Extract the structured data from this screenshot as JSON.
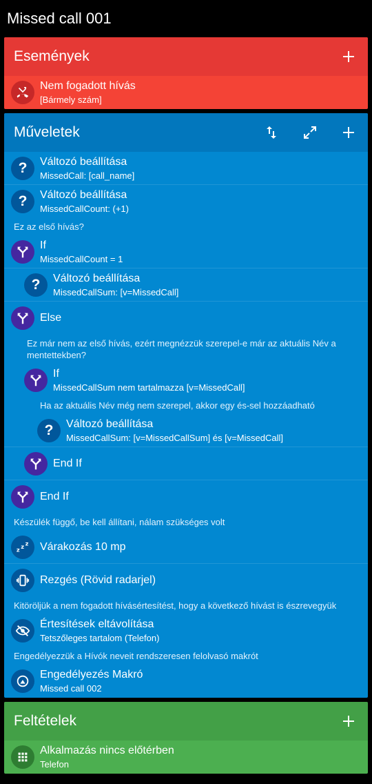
{
  "title": "Missed call 001",
  "triggers": {
    "header": "Események",
    "items": [
      {
        "title": "Nem fogadott hívás",
        "sub": "[Bármely szám]"
      }
    ]
  },
  "actions": {
    "header": "Műveletek",
    "rows": [
      {
        "kind": "item",
        "indent": 0,
        "icon": "question-icon",
        "title": "Változó beállítása",
        "sub": "MissedCall: [call_name]"
      },
      {
        "kind": "item",
        "indent": 0,
        "icon": "question-icon",
        "title": "Változó beállítása",
        "sub": "MissedCallCount: (+1)"
      },
      {
        "kind": "comment",
        "indent": 0,
        "text": "Ez az első hívás?"
      },
      {
        "kind": "item",
        "indent": 0,
        "icon": "branch-icon",
        "title": "If",
        "sub": "MissedCallCount = 1"
      },
      {
        "kind": "item",
        "indent": 1,
        "icon": "question-icon",
        "title": "Változó beállítása",
        "sub": "MissedCallSum: [v=MissedCall]"
      },
      {
        "kind": "item",
        "indent": 0,
        "icon": "branch-icon",
        "title": "Else",
        "sub": ""
      },
      {
        "kind": "comment",
        "indent": 1,
        "text": "Ez már nem az első hívás, ezért megnézzük szerepel-e már az aktuális Név a mentettekben?"
      },
      {
        "kind": "item",
        "indent": 1,
        "icon": "branch-icon",
        "title": "If",
        "sub": "MissedCallSum nem tartalmazza [v=MissedCall]"
      },
      {
        "kind": "comment",
        "indent": 2,
        "text": "Ha az aktuális Név még nem szerepel, akkor egy és-sel hozzáadható"
      },
      {
        "kind": "item",
        "indent": 2,
        "icon": "question-icon",
        "title": "Változó beállítása",
        "sub": "MissedCallSum: [v=MissedCallSum] és [v=MissedCall]"
      },
      {
        "kind": "item",
        "indent": 1,
        "icon": "branch-icon",
        "title": "End If",
        "sub": ""
      },
      {
        "kind": "item",
        "indent": 0,
        "icon": "branch-icon",
        "title": "End If",
        "sub": ""
      },
      {
        "kind": "comment",
        "indent": 0,
        "text": "Készülék függő, be kell állítani, nálam szükséges volt"
      },
      {
        "kind": "item",
        "indent": 0,
        "icon": "sleep-icon",
        "title": "Várakozás 10 mp",
        "sub": ""
      },
      {
        "kind": "item",
        "indent": 0,
        "icon": "vibrate-icon",
        "title": "Rezgés (Rövid radarjel)",
        "sub": ""
      },
      {
        "kind": "comment",
        "indent": 0,
        "text": "Kitöröljük a nem fogadott hívásértesítést, hogy a következő hívást is észrevegyük"
      },
      {
        "kind": "item",
        "indent": 0,
        "icon": "eye-off-icon",
        "title": "Értesítések eltávolítása",
        "sub": "Tetszőleges tartalom (Telefon)"
      },
      {
        "kind": "comment",
        "indent": 0,
        "text": "Engedélyezzük a Hívók neveit rendszeresen felolvasó makrót"
      },
      {
        "kind": "item",
        "indent": 0,
        "icon": "macro-icon",
        "title": "Engedélyezés Makró",
        "sub": "Missed call 002"
      }
    ]
  },
  "constraints": {
    "header": "Feltételek",
    "items": [
      {
        "title": "Alkalmazás nincs előtérben",
        "sub": "Telefon"
      }
    ]
  },
  "colors": {
    "trigger_bg": "#f44336",
    "trigger_header": "#e53935",
    "action_bg": "#0288d1",
    "action_header": "#0277bd",
    "constraint_bg": "#4caf50",
    "constraint_header": "#43a047"
  }
}
